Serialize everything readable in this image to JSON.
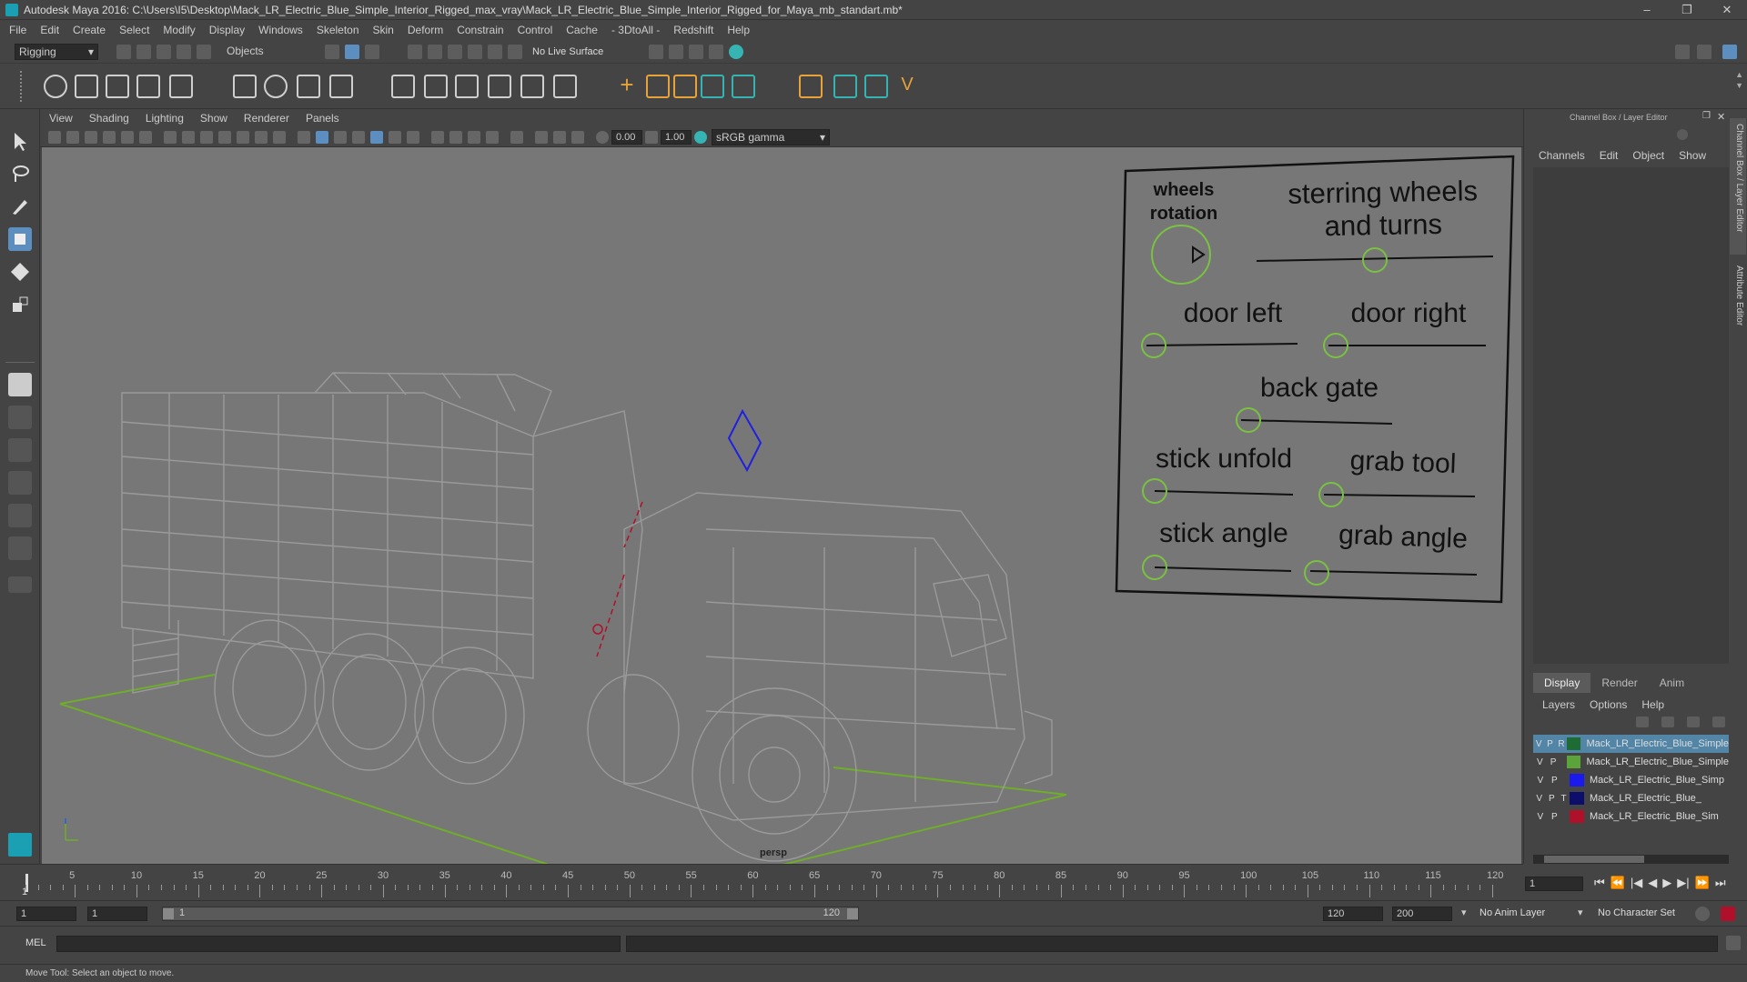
{
  "window": {
    "title": "Autodesk Maya 2016: C:\\Users\\I5\\Desktop\\Mack_LR_Electric_Blue_Simple_Interior_Rigged_max_vray\\Mack_LR_Electric_Blue_Simple_Interior_Rigged_for_Maya_mb_standart.mb*",
    "minimize": "–",
    "maximize": "❐",
    "close": "✕"
  },
  "menu": [
    "File",
    "Edit",
    "Create",
    "Select",
    "Modify",
    "Display",
    "Windows",
    "Skeleton",
    "Skin",
    "Deform",
    "Constrain",
    "Control",
    "Cache",
    "- 3DtoAll -",
    "Redshift",
    "Help"
  ],
  "status_line": {
    "mode": "Rigging",
    "selection_mask": "Objects",
    "live_surface": "No Live Surface"
  },
  "viewport": {
    "menu": [
      "View",
      "Shading",
      "Lighting",
      "Show",
      "Renderer",
      "Panels"
    ],
    "near_value": "0.00",
    "far_value": "1.00",
    "color_space": "sRGB gamma",
    "camera_label": "persp",
    "controls": {
      "wheels_rotation": "wheels rotation",
      "steering": "sterring wheels and turns",
      "door_left": "door left",
      "door_right": "door right",
      "back_gate": "back gate",
      "stick_unfold": "stick unfold",
      "grab_tool": "grab tool",
      "stick_angle": "stick angle",
      "grab_angle": "grab angle"
    }
  },
  "channel_box": {
    "title": "Channel Box / Layer Editor",
    "menu": [
      "Channels",
      "Edit",
      "Object",
      "Show"
    ],
    "side_tabs": [
      "Channel Box / Layer Editor",
      "Attribute Editor"
    ]
  },
  "layer_editor": {
    "tabs": [
      "Display",
      "Render",
      "Anim"
    ],
    "menu": [
      "Layers",
      "Options",
      "Help"
    ],
    "layers": [
      {
        "v": "V",
        "p": "P",
        "r": "R",
        "name": "Mack_LR_Electric_Blue_Simple",
        "color": "#1e6b34",
        "selected": true
      },
      {
        "v": "V",
        "p": "P",
        "r": "",
        "name": "Mack_LR_Electric_Blue_Simple",
        "color": "#5aa43a",
        "selected": false
      },
      {
        "v": "V",
        "p": "P",
        "r": "",
        "name": "Mack_LR_Electric_Blue_Simp",
        "color": "#1a1aee",
        "selected": false
      },
      {
        "v": "V",
        "p": "P",
        "r": "T",
        "name": "Mack_LR_Electric_Blue_",
        "color": "#0d0d6b",
        "selected": false
      },
      {
        "v": "V",
        "p": "P",
        "r": "",
        "name": "Mack_LR_Electric_Blue_Sim",
        "color": "#b0102a",
        "selected": false
      }
    ]
  },
  "timeline": {
    "ticks": [
      "5",
      "10",
      "15",
      "20",
      "25",
      "30",
      "35",
      "40",
      "45",
      "50",
      "55",
      "60",
      "65",
      "70",
      "75",
      "80",
      "85",
      "90",
      "95",
      "100",
      "105",
      "110",
      "115",
      "120"
    ],
    "start_tick": "1",
    "current_frame": "1"
  },
  "range": {
    "start": "1",
    "anim_start": "1",
    "slider_start": "1",
    "slider_end": "120",
    "end": "120",
    "anim_end": "200",
    "anim_layer": "No Anim Layer",
    "character_set": "No Character Set"
  },
  "command_line": {
    "label": "MEL"
  },
  "help_line": "Move Tool: Select an object to move.",
  "colors": {
    "wire": "#9a9a9a",
    "ground_grid": "#6fae2a",
    "controller": "#7ac142",
    "selection_blue": "#5285a6"
  }
}
